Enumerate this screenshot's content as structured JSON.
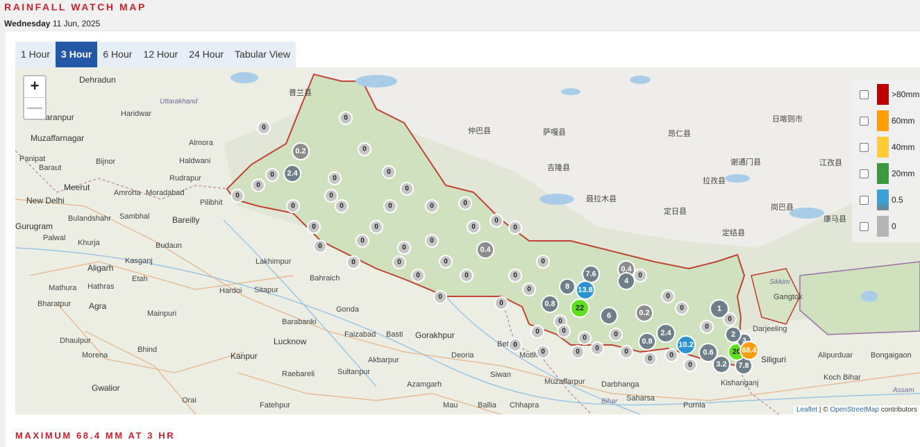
{
  "header": {
    "title": "RAINFALL WATCH MAP",
    "date_day": "Wednesday",
    "date_rest": "11 Jun, 2025"
  },
  "tabs": [
    {
      "label": "1 Hour",
      "active": false
    },
    {
      "label": "3 Hour",
      "active": true
    },
    {
      "label": "6 Hour",
      "active": false
    },
    {
      "label": "12 Hour",
      "active": false
    },
    {
      "label": "24 Hour",
      "active": false
    },
    {
      "label": "Tabular View",
      "active": false
    }
  ],
  "map": {
    "zoom_in": "+",
    "zoom_out": "—",
    "attribution_leaflet": "Leaflet",
    "attribution_sep": " | © ",
    "attribution_osm": "OpenStreetMap",
    "attribution_tail": " contributors",
    "legend": [
      {
        "label": ">80mm",
        "color": "#c00000"
      },
      {
        "label": "60mm",
        "color": "#ffa000"
      },
      {
        "label": "40mm",
        "color": "#ffcc33"
      },
      {
        "label": "20mm",
        "color": "#3c9a3c"
      },
      {
        "label": "0.5",
        "color": "#3aa0d8"
      },
      {
        "label": "0",
        "color": "#b5b5b5"
      }
    ],
    "places": [
      "Dehradun",
      "Haridwar",
      "Saharanpur",
      "Uttarakhand",
      "Almora",
      "Muzaffarnagar",
      "Haldwani",
      "Bijnor",
      "Panipat",
      "Baraut",
      "Rudrapur",
      "Meerut",
      "Amroha",
      "Moradabad",
      "Pilibhit",
      "New Delhi",
      "Bulandshahr",
      "Sambhal",
      "Bareilly",
      "Gurugram",
      "Palwal",
      "Khurja",
      "Budaun",
      "Aligarh",
      "Kasganj",
      "Lakhimpur",
      "Mathura",
      "Hathras",
      "Etah",
      "Hardoi",
      "Sitapur",
      "Bahraich",
      "Bharatpur",
      "Agra",
      "Mainpuri",
      "Gonda",
      "Barabanki",
      "Lucknow",
      "Faizabad",
      "Basti",
      "Gorakhpur",
      "Dhaulpur",
      "Bhind",
      "Morena",
      "Kanpur",
      "Akbarpur",
      "Raebareli",
      "Sultanpur",
      "Deoria",
      "Siwan",
      "Bettiah",
      "Motihari",
      "Muzaffarpur",
      "Darbhanga",
      "Azamgarh",
      "Mau",
      "Ballia",
      "Chhapra",
      "Gwalior",
      "Orai",
      "Fatehpur",
      "Bihar",
      "Saharsa",
      "Purnia",
      "Kishanganj",
      "Siliguri",
      "Sikkim",
      "Gangtok",
      "Alipurduar",
      "Bongaigaon",
      "Koch Bihar",
      "Assam",
      "Darjeeling",
      "普兰县",
      "仲巴县",
      "萨嘎县",
      "吉隆县",
      "聂拉木县",
      "昂仁县",
      "定日县",
      "定结县",
      "拉孜县",
      "谢通门县",
      "日喀则市",
      "岗巴县",
      "康马县",
      "江孜县"
    ],
    "markers_note": "values",
    "markers": [
      "0",
      "0.2",
      "2.4",
      "0.4",
      "7.6",
      "4",
      "13.8",
      "8",
      "0.8",
      "22",
      "6",
      "0.2",
      "1",
      "2.4",
      "0.8",
      "10.2",
      "0.6",
      "3.2",
      "7.8",
      "20",
      "3",
      "68.4",
      "2",
      "0"
    ]
  },
  "footer": {
    "text": "MAXIMUM 68.4 MM AT 3 HR"
  }
}
